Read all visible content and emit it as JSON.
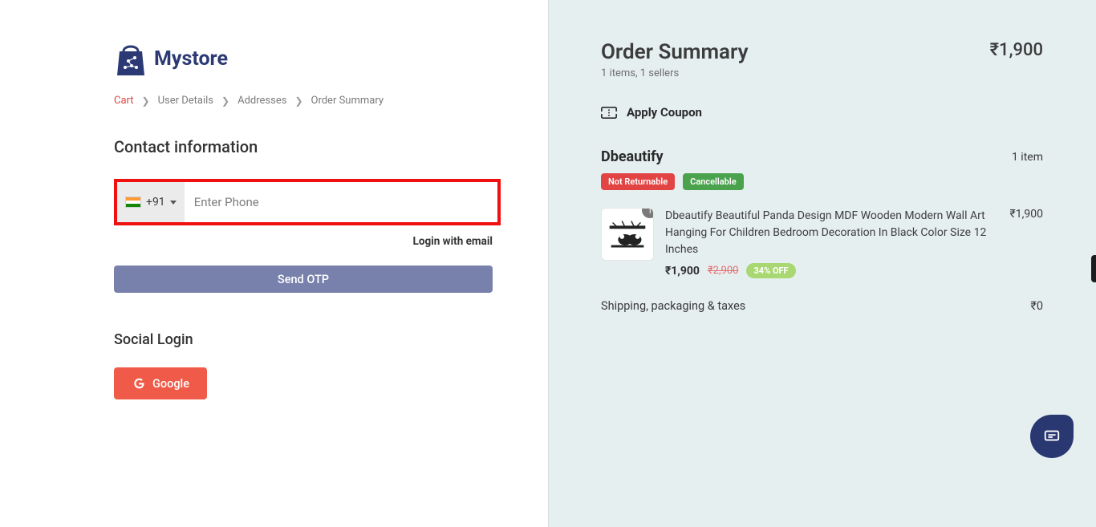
{
  "logo": {
    "text": "Mystore"
  },
  "breadcrumb": {
    "items": [
      "Cart",
      "User Details",
      "Addresses",
      "Order Summary"
    ]
  },
  "contact": {
    "heading": "Contact information",
    "country_code": "+91",
    "phone_placeholder": "Enter Phone",
    "login_email": "Login with email",
    "send_otp": "Send OTP"
  },
  "social": {
    "heading": "Social Login",
    "google": "Google"
  },
  "summary": {
    "title": "Order Summary",
    "total": "₹1,900",
    "sub": "1 items, 1 sellers",
    "coupon": "Apply Coupon"
  },
  "seller": {
    "name": "Dbeautify",
    "count": "1 item",
    "pill_not_returnable": "Not Returnable",
    "pill_cancellable": "Cancellable"
  },
  "item": {
    "qty": "1",
    "title": "Dbeautify Beautiful Panda Design MDF Wooden Modern Wall Art Hanging For Children Bedroom Decoration In Black Color Size 12 Inches",
    "price_now": "₹1,900",
    "price_old": "₹2,900",
    "discount": "34% OFF",
    "line_total": "₹1,900"
  },
  "shipping": {
    "label": "Shipping, packaging & taxes",
    "value": "₹0"
  }
}
